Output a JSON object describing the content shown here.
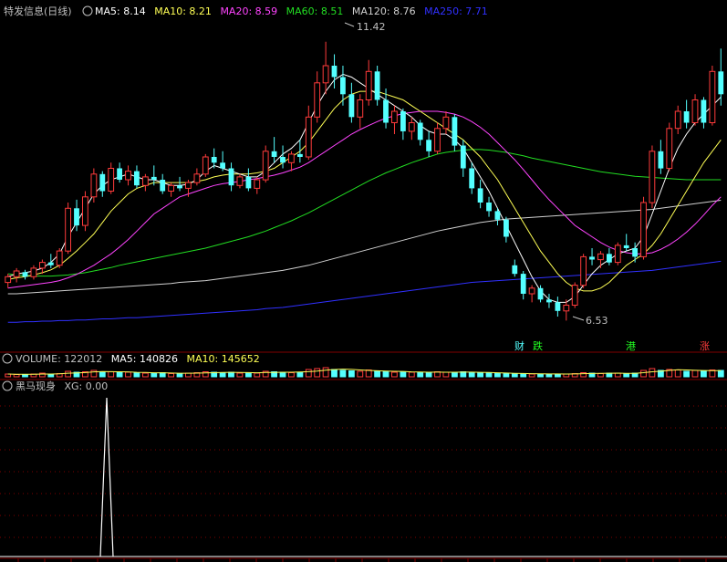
{
  "window": {
    "title": "特发信息(日线)"
  },
  "colors": {
    "bg": "#000000",
    "up": "#ff3b3b",
    "down": "#54ffff",
    "grid": "#800000",
    "ma5": "#ffffff",
    "ma10": "#ffff55",
    "ma20": "#ff44ff",
    "ma60": "#22dd22",
    "ma120": "#d0d0d0",
    "ma250": "#3030ff",
    "label": "#c0c0c0",
    "tag_cai": "#54ffff",
    "tag_die": "#22ff22",
    "tag_gang": "#22ff22",
    "tag_zhang": "#ff3b3b"
  },
  "main_panel": {
    "indicators": [
      {
        "label": "MA5: 8.14",
        "color": "#ffffff"
      },
      {
        "label": "MA10: 8.21",
        "color": "#ffff55"
      },
      {
        "label": "MA20: 8.59",
        "color": "#ff44ff"
      },
      {
        "label": "MA60: 8.51",
        "color": "#22dd22"
      },
      {
        "label": "MA120: 8.76",
        "color": "#d0d0d0"
      },
      {
        "label": "MA250: 7.71",
        "color": "#3030ff"
      }
    ],
    "high_label": "11.42",
    "low_label": "6.53",
    "event_tags": [
      {
        "text": "财",
        "color": "#54ffff",
        "x": 0.708
      },
      {
        "text": "跌",
        "color": "#22ff22",
        "x": 0.733
      },
      {
        "text": "港",
        "color": "#22ff22",
        "x": 0.871
      },
      {
        "text": "涨",
        "color": "#ff3b3b",
        "x": 0.972
      }
    ]
  },
  "volume_panel": {
    "title": "VOLUME: 122012",
    "ma5_label": "MA5: 140826",
    "ma10_label": "MA10: 145652"
  },
  "indicator_panel": {
    "title": "黑马现身",
    "xg_label": "XG: 0.00"
  },
  "chart_data": {
    "type": "candlestick",
    "ylim": [
      6.2,
      11.8
    ],
    "high": 11.42,
    "low": 6.53,
    "ohlc": [
      [
        7.2,
        7.35,
        7.1,
        7.3
      ],
      [
        7.3,
        7.45,
        7.2,
        7.4
      ],
      [
        7.38,
        7.42,
        7.25,
        7.3
      ],
      [
        7.3,
        7.5,
        7.25,
        7.45
      ],
      [
        7.45,
        7.6,
        7.35,
        7.55
      ],
      [
        7.55,
        7.7,
        7.45,
        7.5
      ],
      [
        7.5,
        7.8,
        7.45,
        7.75
      ],
      [
        7.75,
        8.6,
        7.7,
        8.5
      ],
      [
        8.5,
        8.65,
        8.1,
        8.2
      ],
      [
        8.2,
        8.8,
        8.1,
        8.7
      ],
      [
        8.7,
        9.2,
        8.6,
        9.1
      ],
      [
        9.1,
        9.15,
        8.7,
        8.8
      ],
      [
        8.8,
        9.3,
        8.75,
        9.2
      ],
      [
        9.2,
        9.3,
        8.95,
        9.0
      ],
      [
        9.0,
        9.25,
        8.9,
        9.15
      ],
      [
        9.15,
        9.25,
        8.85,
        8.9
      ],
      [
        8.9,
        9.1,
        8.8,
        9.05
      ],
      [
        9.05,
        9.25,
        8.9,
        9.0
      ],
      [
        9.0,
        9.1,
        8.75,
        8.8
      ],
      [
        8.8,
        8.95,
        8.7,
        8.9
      ],
      [
        8.9,
        9.05,
        8.8,
        8.85
      ],
      [
        8.85,
        9.0,
        8.7,
        8.95
      ],
      [
        8.95,
        9.2,
        8.9,
        9.1
      ],
      [
        9.1,
        9.45,
        9.05,
        9.4
      ],
      [
        9.4,
        9.55,
        9.2,
        9.3
      ],
      [
        9.3,
        9.5,
        9.15,
        9.2
      ],
      [
        9.2,
        9.3,
        8.8,
        8.9
      ],
      [
        8.9,
        9.1,
        8.85,
        9.05
      ],
      [
        9.05,
        9.2,
        8.8,
        8.85
      ],
      [
        8.85,
        9.05,
        8.75,
        9.0
      ],
      [
        9.0,
        9.6,
        8.95,
        9.5
      ],
      [
        9.5,
        9.75,
        9.3,
        9.4
      ],
      [
        9.4,
        9.6,
        9.2,
        9.3
      ],
      [
        9.3,
        9.5,
        9.15,
        9.45
      ],
      [
        9.45,
        9.7,
        9.3,
        9.4
      ],
      [
        9.4,
        10.3,
        9.35,
        10.1
      ],
      [
        10.1,
        10.9,
        10.0,
        10.7
      ],
      [
        10.7,
        11.42,
        10.5,
        11.0
      ],
      [
        11.0,
        11.2,
        10.6,
        10.8
      ],
      [
        10.8,
        11.0,
        10.3,
        10.5
      ],
      [
        10.5,
        10.7,
        10.0,
        10.1
      ],
      [
        10.1,
        10.5,
        9.9,
        10.4
      ],
      [
        10.4,
        11.1,
        10.3,
        10.9
      ],
      [
        10.9,
        11.0,
        10.3,
        10.4
      ],
      [
        10.4,
        10.6,
        9.9,
        10.0
      ],
      [
        10.0,
        10.3,
        9.8,
        10.2
      ],
      [
        10.2,
        10.25,
        9.7,
        9.85
      ],
      [
        9.85,
        10.1,
        9.7,
        10.0
      ],
      [
        10.0,
        10.05,
        9.6,
        9.7
      ],
      [
        9.7,
        9.85,
        9.4,
        9.5
      ],
      [
        9.5,
        10.0,
        9.45,
        9.9
      ],
      [
        9.9,
        10.2,
        9.8,
        10.1
      ],
      [
        10.1,
        10.15,
        9.5,
        9.6
      ],
      [
        9.6,
        9.7,
        9.05,
        9.2
      ],
      [
        9.2,
        9.3,
        8.75,
        8.85
      ],
      [
        8.85,
        9.0,
        8.5,
        8.6
      ],
      [
        8.6,
        8.7,
        8.35,
        8.45
      ],
      [
        8.45,
        8.5,
        8.2,
        8.3
      ],
      [
        8.3,
        8.35,
        7.9,
        8.0
      ],
      [
        7.5,
        7.6,
        7.3,
        7.35
      ],
      [
        7.35,
        7.4,
        6.9,
        7.0
      ],
      [
        7.0,
        7.15,
        6.85,
        7.1
      ],
      [
        7.1,
        7.15,
        6.85,
        6.9
      ],
      [
        6.9,
        7.0,
        6.75,
        6.85
      ],
      [
        6.85,
        6.95,
        6.6,
        6.7
      ],
      [
        6.7,
        6.9,
        6.53,
        6.8
      ],
      [
        6.8,
        7.2,
        6.75,
        7.15
      ],
      [
        7.15,
        7.7,
        7.1,
        7.65
      ],
      [
        7.65,
        7.8,
        7.5,
        7.6
      ],
      [
        7.6,
        7.75,
        7.45,
        7.7
      ],
      [
        7.7,
        7.8,
        7.5,
        7.55
      ],
      [
        7.55,
        7.9,
        7.5,
        7.85
      ],
      [
        7.85,
        8.05,
        7.75,
        7.8
      ],
      [
        7.8,
        7.9,
        7.55,
        7.65
      ],
      [
        7.65,
        8.7,
        7.6,
        8.6
      ],
      [
        8.6,
        9.6,
        8.5,
        9.5
      ],
      [
        9.5,
        9.7,
        9.1,
        9.2
      ],
      [
        9.2,
        10.0,
        9.15,
        9.9
      ],
      [
        9.9,
        10.3,
        9.8,
        10.2
      ],
      [
        10.2,
        10.4,
        9.9,
        10.0
      ],
      [
        10.0,
        10.5,
        9.95,
        10.4
      ],
      [
        10.4,
        10.45,
        9.9,
        10.0
      ],
      [
        10.0,
        11.0,
        9.95,
        10.9
      ],
      [
        10.9,
        11.3,
        10.3,
        10.5
      ]
    ],
    "ma5": [
      7.3,
      7.35,
      7.37,
      7.4,
      7.45,
      7.55,
      7.7,
      8.0,
      8.25,
      8.5,
      8.75,
      8.9,
      9.0,
      9.05,
      9.1,
      9.05,
      9.0,
      9.0,
      8.95,
      8.9,
      8.9,
      8.92,
      9.0,
      9.15,
      9.25,
      9.2,
      9.15,
      9.1,
      9.05,
      9.05,
      9.15,
      9.3,
      9.45,
      9.55,
      9.7,
      10.0,
      10.3,
      10.55,
      10.75,
      10.85,
      10.8,
      10.7,
      10.6,
      10.5,
      10.4,
      10.3,
      10.2,
      10.1,
      9.95,
      9.85,
      9.8,
      9.8,
      9.7,
      9.55,
      9.3,
      9.05,
      8.8,
      8.5,
      8.2,
      7.9,
      7.6,
      7.3,
      7.05,
      6.9,
      6.85,
      6.85,
      6.95,
      7.15,
      7.35,
      7.5,
      7.6,
      7.7,
      7.75,
      7.8,
      8.0,
      8.4,
      8.8,
      9.2,
      9.55,
      9.8,
      10.0,
      10.15,
      10.3,
      10.45
    ],
    "ma10": [
      7.25,
      7.28,
      7.3,
      7.33,
      7.37,
      7.42,
      7.5,
      7.62,
      7.75,
      7.9,
      8.05,
      8.25,
      8.45,
      8.6,
      8.75,
      8.85,
      8.9,
      8.95,
      8.95,
      8.95,
      8.95,
      8.95,
      8.97,
      9.0,
      9.05,
      9.08,
      9.1,
      9.1,
      9.1,
      9.12,
      9.15,
      9.2,
      9.3,
      9.4,
      9.5,
      9.65,
      9.85,
      10.05,
      10.25,
      10.4,
      10.5,
      10.55,
      10.55,
      10.55,
      10.5,
      10.45,
      10.4,
      10.3,
      10.2,
      10.1,
      10.0,
      9.9,
      9.8,
      9.7,
      9.55,
      9.4,
      9.2,
      9.0,
      8.75,
      8.5,
      8.25,
      8.0,
      7.75,
      7.55,
      7.35,
      7.2,
      7.1,
      7.05,
      7.05,
      7.1,
      7.2,
      7.35,
      7.5,
      7.6,
      7.7,
      7.85,
      8.05,
      8.3,
      8.55,
      8.8,
      9.05,
      9.3,
      9.5,
      9.7
    ],
    "ma20": [
      7.1,
      7.12,
      7.14,
      7.16,
      7.18,
      7.2,
      7.23,
      7.28,
      7.34,
      7.42,
      7.5,
      7.6,
      7.7,
      7.82,
      7.95,
      8.1,
      8.25,
      8.4,
      8.5,
      8.6,
      8.7,
      8.75,
      8.8,
      8.85,
      8.9,
      8.93,
      8.95,
      8.97,
      9.0,
      9.02,
      9.05,
      9.08,
      9.12,
      9.17,
      9.22,
      9.3,
      9.4,
      9.5,
      9.6,
      9.7,
      9.8,
      9.88,
      9.95,
      10.02,
      10.08,
      10.12,
      10.16,
      10.18,
      10.2,
      10.2,
      10.2,
      10.18,
      10.15,
      10.1,
      10.02,
      9.92,
      9.8,
      9.65,
      9.5,
      9.35,
      9.18,
      9.0,
      8.82,
      8.65,
      8.5,
      8.35,
      8.2,
      8.1,
      8.0,
      7.9,
      7.82,
      7.76,
      7.72,
      7.7,
      7.7,
      7.72,
      7.78,
      7.86,
      7.96,
      8.08,
      8.22,
      8.38,
      8.55,
      8.7
    ],
    "ma60": [
      7.35,
      7.33,
      7.32,
      7.31,
      7.31,
      7.31,
      7.32,
      7.33,
      7.35,
      7.37,
      7.4,
      7.43,
      7.46,
      7.5,
      7.53,
      7.56,
      7.59,
      7.62,
      7.65,
      7.68,
      7.71,
      7.74,
      7.77,
      7.8,
      7.84,
      7.88,
      7.92,
      7.96,
      8.0,
      8.05,
      8.1,
      8.16,
      8.22,
      8.28,
      8.35,
      8.42,
      8.5,
      8.58,
      8.66,
      8.74,
      8.82,
      8.9,
      8.98,
      9.05,
      9.12,
      9.18,
      9.24,
      9.3,
      9.35,
      9.4,
      9.45,
      9.48,
      9.5,
      9.52,
      9.53,
      9.53,
      9.52,
      9.5,
      9.48,
      9.45,
      9.42,
      9.38,
      9.35,
      9.32,
      9.29,
      9.26,
      9.23,
      9.2,
      9.17,
      9.14,
      9.12,
      9.1,
      9.08,
      9.06,
      9.05,
      9.04,
      9.03,
      9.02,
      9.01,
      9.0,
      9.0,
      9.0,
      9.0,
      9.0
    ],
    "ma120": [
      7.0,
      7.0,
      7.01,
      7.02,
      7.03,
      7.04,
      7.05,
      7.06,
      7.07,
      7.08,
      7.09,
      7.1,
      7.11,
      7.12,
      7.13,
      7.14,
      7.15,
      7.16,
      7.17,
      7.18,
      7.2,
      7.21,
      7.22,
      7.23,
      7.25,
      7.27,
      7.29,
      7.31,
      7.33,
      7.35,
      7.37,
      7.39,
      7.41,
      7.44,
      7.47,
      7.5,
      7.54,
      7.58,
      7.62,
      7.66,
      7.7,
      7.74,
      7.78,
      7.82,
      7.86,
      7.9,
      7.94,
      7.98,
      8.02,
      8.06,
      8.1,
      8.13,
      8.16,
      8.19,
      8.22,
      8.25,
      8.27,
      8.29,
      8.31,
      8.32,
      8.33,
      8.34,
      8.35,
      8.36,
      8.37,
      8.38,
      8.39,
      8.4,
      8.41,
      8.42,
      8.43,
      8.44,
      8.45,
      8.46,
      8.47,
      8.48,
      8.5,
      8.52,
      8.54,
      8.56,
      8.58,
      8.6,
      8.62,
      8.64
    ],
    "ma250": [
      6.5,
      6.5,
      6.51,
      6.51,
      6.52,
      6.52,
      6.53,
      6.53,
      6.54,
      6.54,
      6.55,
      6.56,
      6.56,
      6.57,
      6.58,
      6.58,
      6.59,
      6.6,
      6.61,
      6.62,
      6.63,
      6.64,
      6.65,
      6.66,
      6.67,
      6.68,
      6.69,
      6.7,
      6.71,
      6.72,
      6.74,
      6.75,
      6.76,
      6.78,
      6.8,
      6.82,
      6.84,
      6.86,
      6.88,
      6.9,
      6.92,
      6.94,
      6.96,
      6.98,
      7.0,
      7.02,
      7.04,
      7.06,
      7.08,
      7.1,
      7.12,
      7.14,
      7.16,
      7.18,
      7.2,
      7.21,
      7.22,
      7.23,
      7.24,
      7.25,
      7.26,
      7.27,
      7.28,
      7.29,
      7.3,
      7.31,
      7.32,
      7.33,
      7.34,
      7.35,
      7.36,
      7.37,
      7.38,
      7.39,
      7.4,
      7.41,
      7.43,
      7.45,
      7.47,
      7.49,
      7.51,
      7.53,
      7.55,
      7.57
    ],
    "volume": [
      0.3,
      0.25,
      0.25,
      0.3,
      0.4,
      0.3,
      0.35,
      0.6,
      0.5,
      0.55,
      0.7,
      0.5,
      0.55,
      0.45,
      0.5,
      0.45,
      0.4,
      0.4,
      0.45,
      0.35,
      0.35,
      0.4,
      0.45,
      0.55,
      0.5,
      0.45,
      0.5,
      0.4,
      0.45,
      0.4,
      0.6,
      0.55,
      0.5,
      0.45,
      0.5,
      0.8,
      0.9,
      1.0,
      0.8,
      0.7,
      0.65,
      0.6,
      0.75,
      0.6,
      0.55,
      0.5,
      0.55,
      0.5,
      0.5,
      0.45,
      0.55,
      0.5,
      0.5,
      0.55,
      0.45,
      0.45,
      0.4,
      0.35,
      0.4,
      0.3,
      0.35,
      0.3,
      0.3,
      0.3,
      0.3,
      0.3,
      0.35,
      0.45,
      0.4,
      0.35,
      0.4,
      0.4,
      0.35,
      0.4,
      0.7,
      0.9,
      0.7,
      0.8,
      0.75,
      0.6,
      0.7,
      0.6,
      0.75,
      0.7
    ],
    "xg_signal_index": 12
  }
}
